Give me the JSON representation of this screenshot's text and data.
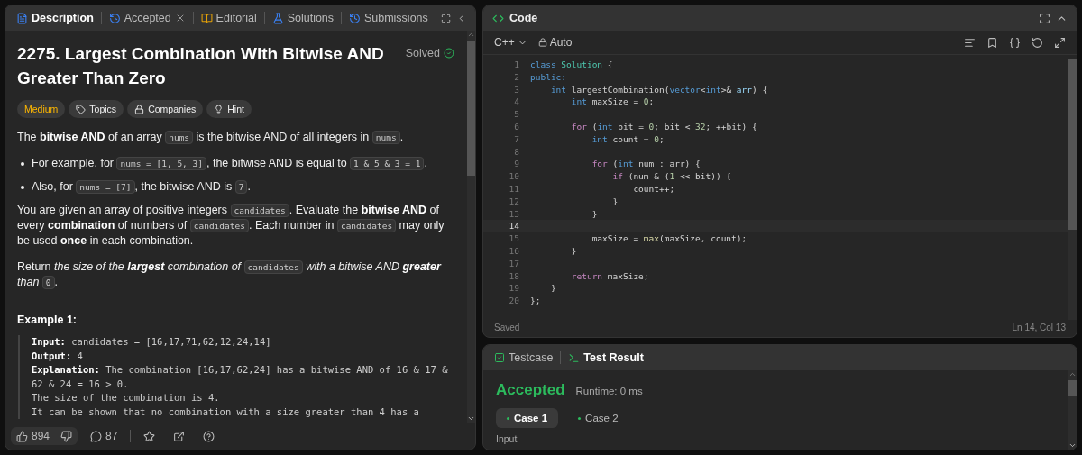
{
  "description_panel": {
    "tabs": [
      {
        "label": "Description",
        "selected": true,
        "closable": false
      },
      {
        "label": "Accepted",
        "selected": false,
        "closable": true
      },
      {
        "label": "Editorial",
        "selected": false,
        "closable": false
      },
      {
        "label": "Solutions",
        "selected": false,
        "closable": false
      },
      {
        "label": "Submissions",
        "selected": false,
        "closable": false
      }
    ],
    "title": "2275. Largest Combination With Bitwise AND Greater Than Zero",
    "status": "Solved",
    "tags": [
      {
        "label": "Medium",
        "kind": "difficulty"
      },
      {
        "label": "Topics",
        "kind": "topics"
      },
      {
        "label": "Companies",
        "kind": "companies"
      },
      {
        "label": "Hint",
        "kind": "hint"
      }
    ],
    "body": [
      {
        "kind": "paragraph",
        "parts": [
          {
            "t": "The **bitwise AND** of an array "
          },
          {
            "code": "nums"
          },
          {
            "t": " is the bitwise AND of all integers in "
          },
          {
            "code": "nums"
          },
          {
            "t": "."
          }
        ]
      },
      {
        "kind": "bullet",
        "parts": [
          {
            "t": "For example, for "
          },
          {
            "code": "nums = [1, 5, 3]"
          },
          {
            "t": ", the bitwise AND is equal to "
          },
          {
            "code": "1 & 5 & 3 = 1"
          },
          {
            "t": "."
          }
        ]
      },
      {
        "kind": "bullet",
        "parts": [
          {
            "t": "Also, for "
          },
          {
            "code": "nums = [7]"
          },
          {
            "t": ", the bitwise AND is "
          },
          {
            "code": "7"
          },
          {
            "t": "."
          }
        ]
      },
      {
        "kind": "paragraph",
        "parts": [
          {
            "t": "You are given an array of positive integers "
          },
          {
            "code": "candidates"
          },
          {
            "t": ". Evaluate the **bitwise AND** of every **combination** of numbers of "
          },
          {
            "code": "candidates"
          },
          {
            "t": ". Each number in "
          },
          {
            "code": "candidates"
          },
          {
            "t": " may only be used **once** in each combination."
          }
        ]
      },
      {
        "kind": "paragraph",
        "parts": [
          {
            "t": "Return "
          },
          {
            "t": "the size of the **largest** combination of ",
            "em": true
          },
          {
            "code": "candidates"
          },
          {
            "t": " with a bitwise AND **greater** than ",
            "em": true
          },
          {
            "code": "0"
          },
          {
            "t": "."
          }
        ]
      }
    ],
    "example": {
      "heading": "Example 1:",
      "lines": [
        {
          "label": "Input:",
          "text": "candidates = [16,17,71,62,12,24,14]"
        },
        {
          "label": "Output:",
          "text": "4"
        },
        {
          "label": "Explanation:",
          "text": "The combination [16,17,62,24] has a bitwise AND of 16 & 17 & 62 & 24 = 16 > 0."
        },
        {
          "text": "The size of the combination is 4."
        },
        {
          "text": "It can be shown that no combination with a size greater than 4 has a"
        }
      ]
    },
    "footer": {
      "likes": "894",
      "comments": "87"
    }
  },
  "code_panel": {
    "title": "Code",
    "language": "C++",
    "mode": "Auto",
    "lines": [
      {
        "n": "1",
        "active": false,
        "tokens": [
          {
            "kind": "keyword",
            "text": "class"
          },
          {
            "kind": "class",
            "text": " Solution"
          },
          {
            "kind": "plain",
            "text": " {"
          }
        ]
      },
      {
        "n": "2",
        "active": false,
        "tokens": [
          {
            "kind": "keyword",
            "text": "public:"
          }
        ]
      },
      {
        "n": "3",
        "active": false,
        "tokens": [
          {
            "kind": "keyword",
            "text": "    int"
          },
          {
            "kind": "plain",
            "text": " largestCombination("
          },
          {
            "kind": "keyword",
            "text": "vector"
          },
          {
            "kind": "plain",
            "text": "<"
          },
          {
            "kind": "keyword",
            "text": "int"
          },
          {
            "kind": "plain",
            "text": ">&"
          },
          {
            "kind": "variable",
            "text": " arr"
          },
          {
            "kind": "plain",
            "text": ") {"
          }
        ]
      },
      {
        "n": "4",
        "active": false,
        "tokens": [
          {
            "kind": "keyword",
            "text": "        int"
          },
          {
            "kind": "plain",
            "text": " maxSize = "
          },
          {
            "kind": "number",
            "text": "0"
          },
          {
            "kind": "plain",
            "text": ";"
          }
        ]
      },
      {
        "n": "5",
        "active": false
      },
      {
        "n": "6",
        "active": false,
        "tokens": [
          {
            "kind": "control",
            "text": "        for"
          },
          {
            "kind": "plain",
            "text": " ("
          },
          {
            "kind": "keyword",
            "text": "int"
          },
          {
            "kind": "plain",
            "text": " bit = "
          },
          {
            "kind": "number",
            "text": "0"
          },
          {
            "kind": "plain",
            "text": "; bit < "
          },
          {
            "kind": "number",
            "text": "32"
          },
          {
            "kind": "plain",
            "text": "; ++bit) {"
          }
        ]
      },
      {
        "n": "7",
        "active": false,
        "tokens": [
          {
            "kind": "keyword",
            "text": "            int"
          },
          {
            "kind": "plain",
            "text": " count = "
          },
          {
            "kind": "number",
            "text": "0"
          },
          {
            "kind": "plain",
            "text": ";"
          }
        ]
      },
      {
        "n": "8",
        "active": false
      },
      {
        "n": "9",
        "active": false,
        "tokens": [
          {
            "kind": "control",
            "text": "            for"
          },
          {
            "kind": "plain",
            "text": " ("
          },
          {
            "kind": "keyword",
            "text": "int"
          },
          {
            "kind": "plain",
            "text": " num : arr) {"
          }
        ]
      },
      {
        "n": "10",
        "active": false,
        "tokens": [
          {
            "kind": "control",
            "text": "                if"
          },
          {
            "kind": "plain",
            "text": " (num & ("
          },
          {
            "kind": "number",
            "text": "1"
          },
          {
            "kind": "plain",
            "text": " << bit)) {"
          }
        ]
      },
      {
        "n": "11",
        "active": false,
        "tokens": [
          {
            "kind": "plain",
            "text": "                    count++;"
          }
        ]
      },
      {
        "n": "12",
        "active": false,
        "tokens": [
          {
            "kind": "plain",
            "text": "                }"
          }
        ]
      },
      {
        "n": "13",
        "active": false,
        "tokens": [
          {
            "kind": "plain",
            "text": "            }"
          }
        ]
      },
      {
        "n": "14",
        "active": true
      },
      {
        "n": "15",
        "active": false,
        "tokens": [
          {
            "kind": "plain",
            "text": "            maxSize = "
          },
          {
            "kind": "function",
            "text": "max"
          },
          {
            "kind": "plain",
            "text": "(maxSize, count);"
          }
        ]
      },
      {
        "n": "16",
        "active": false,
        "tokens": [
          {
            "kind": "plain",
            "text": "        }"
          }
        ]
      },
      {
        "n": "17",
        "active": false
      },
      {
        "n": "18",
        "active": false,
        "tokens": [
          {
            "kind": "control",
            "text": "        return"
          },
          {
            "kind": "plain",
            "text": " maxSize;"
          }
        ]
      },
      {
        "n": "19",
        "active": false,
        "tokens": [
          {
            "kind": "plain",
            "text": "    }"
          }
        ]
      },
      {
        "n": "20",
        "active": false,
        "tokens": [
          {
            "kind": "plain",
            "text": "};"
          }
        ]
      }
    ],
    "save_status": "Saved",
    "cursor": "Ln 14, Col 13"
  },
  "result_panel": {
    "tabs": [
      {
        "label": "Testcase",
        "selected": false
      },
      {
        "label": "Test Result",
        "selected": true
      }
    ],
    "verdict": "Accepted",
    "runtime": "Runtime: 0 ms",
    "cases": [
      {
        "label": "Case 1",
        "selected": true
      },
      {
        "label": "Case 2",
        "selected": false
      }
    ],
    "section_label": "Input"
  }
}
